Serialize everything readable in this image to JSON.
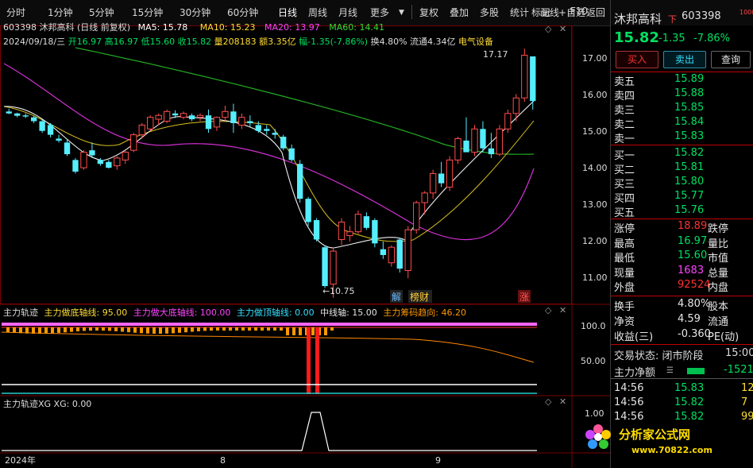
{
  "toolbar": {
    "periods": [
      "分时",
      "1分钟",
      "5分钟",
      "15分钟",
      "30分钟",
      "60分钟",
      "日线",
      "周线",
      "月线",
      "更多"
    ],
    "tools": [
      "复权",
      "叠加",
      "多股",
      "统计",
      "画线",
      "F10",
      "标记",
      "+自选",
      "返回"
    ]
  },
  "info": {
    "line1_code": "603398 沐邦高科 (日线 前复权)",
    "ma5": "MA5: 15.78",
    "ma10": "MA10: 15.23",
    "ma20": "MA20: 13.97",
    "ma60": "MA60: 14.41",
    "line2_date": "2024/09/18/三",
    "open": "开16.97",
    "high": "高16.97",
    "low": "低15.60",
    "close": "收15.82",
    "vol": "量208183",
    "amt": "额3.35亿",
    "chg": "幅-1.35(-7.86%)",
    "turnover": "换4.80%",
    "float": "流通4.34亿",
    "industry": "电气设备"
  },
  "price_axis": [
    "17.00",
    "16.00",
    "15.00",
    "14.00",
    "13.00",
    "12.00",
    "11.00"
  ],
  "annotations": {
    "high": "17.17",
    "low": "10.75",
    "tag_jie": "解",
    "tag_bangcai": "榜财",
    "tag_zhang": "涨"
  },
  "ind1": {
    "name": "主力轨迹",
    "l1": "主力做底轴线: 95.00",
    "l2": "主力做大底轴线: 100.00",
    "l3": "主力做顶轴线: 0.00",
    "l4": "中线轴: 15.00",
    "l5": "主力筹码趋向: 46.20",
    "axis": [
      "100.0",
      "50.00"
    ]
  },
  "ind2": {
    "title": "主力轨迹XG XG: 0.00",
    "axis": "1.00"
  },
  "xaxis": [
    "2024年",
    "8",
    "9"
  ],
  "stock": {
    "name": "沐邦高科",
    "code": "603398",
    "price": "15.82",
    "chg": "-1.35",
    "pct": "-7.86%",
    "tag": "下",
    "sup": "1000"
  },
  "buttons": [
    "买入",
    "卖出",
    "查询"
  ],
  "asks": [
    {
      "label": "卖五",
      "price": "15.89"
    },
    {
      "label": "卖四",
      "price": "15.88"
    },
    {
      "label": "卖三",
      "price": "15.85"
    },
    {
      "label": "卖二",
      "price": "15.84"
    },
    {
      "label": "卖一",
      "price": "15.83"
    }
  ],
  "bids": [
    {
      "label": "买一",
      "price": "15.82"
    },
    {
      "label": "买二",
      "price": "15.81"
    },
    {
      "label": "买三",
      "price": "15.80"
    },
    {
      "label": "买四",
      "price": "15.77"
    },
    {
      "label": "买五",
      "price": "15.76"
    }
  ],
  "stats": [
    {
      "l": "涨停",
      "v": "18.89",
      "r": "跌停"
    },
    {
      "l": "最高",
      "v": "16.97",
      "r": "量比"
    },
    {
      "l": "最低",
      "v": "15.60",
      "r": "市值"
    },
    {
      "l": "现量",
      "v": "1683",
      "r": "总量"
    },
    {
      "l": "外盘",
      "v": "92524",
      "r": "内盘"
    }
  ],
  "stats2": [
    {
      "l": "换手",
      "v": "4.80%",
      "r": "股本"
    },
    {
      "l": "净资",
      "v": "4.59",
      "r": "流通"
    },
    {
      "l": "收益(三)",
      "v": "-0.360",
      "r": "PE(动)"
    }
  ],
  "trade_state": "交易状态: 闭市阶段",
  "trade_time": "15:00",
  "net": {
    "label": "主力净额",
    "value": "-1521"
  },
  "ticks": [
    {
      "t": "14:56",
      "p": "15.83",
      "v": "12"
    },
    {
      "t": "14:56",
      "p": "15.82",
      "v": "7"
    },
    {
      "t": "14:56",
      "p": "15.82",
      "v": "99"
    }
  ],
  "watermark": {
    "text": "分析家公式网",
    "url": "www.70822.com"
  },
  "chart_data": {
    "type": "candlestick",
    "ylim": [
      10.6,
      17.4
    ],
    "candles": [
      [
        15.55,
        15.62,
        15.48,
        15.5
      ],
      [
        15.5,
        15.52,
        15.4,
        15.44
      ],
      [
        15.45,
        15.5,
        15.38,
        15.42
      ],
      [
        15.4,
        15.45,
        15.25,
        15.3
      ],
      [
        15.3,
        15.35,
        15.0,
        15.05
      ],
      [
        15.2,
        15.25,
        14.88,
        14.95
      ],
      [
        14.85,
        14.95,
        14.75,
        14.8
      ],
      [
        14.75,
        14.85,
        14.4,
        14.45
      ],
      [
        14.3,
        14.35,
        13.95,
        14.0
      ],
      [
        14.1,
        14.55,
        14.05,
        14.5
      ],
      [
        14.55,
        14.75,
        14.35,
        14.42
      ],
      [
        14.3,
        14.35,
        14.15,
        14.2
      ],
      [
        14.25,
        14.3,
        14.08,
        14.1
      ],
      [
        14.15,
        14.4,
        14.05,
        14.35
      ],
      [
        14.3,
        14.55,
        14.2,
        14.5
      ],
      [
        14.55,
        15.0,
        14.5,
        14.95
      ],
      [
        14.95,
        15.25,
        14.85,
        15.2
      ],
      [
        15.1,
        15.45,
        15.05,
        15.4
      ],
      [
        15.35,
        15.5,
        15.2,
        15.45
      ],
      [
        15.3,
        15.6,
        15.25,
        15.55
      ],
      [
        15.5,
        15.58,
        15.38,
        15.45
      ],
      [
        15.4,
        15.55,
        15.35,
        15.5
      ],
      [
        15.45,
        15.5,
        15.3,
        15.35
      ],
      [
        15.4,
        15.5,
        15.3,
        15.45
      ],
      [
        15.45,
        15.6,
        15.0,
        15.1
      ],
      [
        15.15,
        15.42,
        15.05,
        15.4
      ],
      [
        15.4,
        15.7,
        15.3,
        15.55
      ],
      [
        15.55,
        15.75,
        15.0,
        15.25
      ],
      [
        15.2,
        15.5,
        15.1,
        15.4
      ],
      [
        15.3,
        15.45,
        15.15,
        15.25
      ],
      [
        15.2,
        15.3,
        15.0,
        15.05
      ],
      [
        15.1,
        15.2,
        14.95,
        15.05
      ],
      [
        15.0,
        15.1,
        14.85,
        14.95
      ],
      [
        14.9,
        14.95,
        14.55,
        14.6
      ],
      [
        14.6,
        14.7,
        14.25,
        14.3
      ],
      [
        14.2,
        14.3,
        13.2,
        13.3
      ],
      [
        13.3,
        13.35,
        12.6,
        12.7
      ],
      [
        12.75,
        12.8,
        12.2,
        12.25
      ],
      [
        12.05,
        12.1,
        11.0,
        11.05
      ],
      [
        11.1,
        12.05,
        10.75,
        11.95
      ],
      [
        12.25,
        12.8,
        12.1,
        12.7
      ],
      [
        12.35,
        12.6,
        12.2,
        12.45
      ],
      [
        12.45,
        13.0,
        12.4,
        12.9
      ],
      [
        12.85,
        12.95,
        12.5,
        12.55
      ],
      [
        12.75,
        12.8,
        12.05,
        12.15
      ],
      [
        12.0,
        12.2,
        11.75,
        11.85
      ],
      [
        11.65,
        12.1,
        11.55,
        12.05
      ],
      [
        12.25,
        12.3,
        11.4,
        11.5
      ],
      [
        11.45,
        12.6,
        11.25,
        12.5
      ],
      [
        12.5,
        13.25,
        12.4,
        13.2
      ],
      [
        13.2,
        13.5,
        12.9,
        13.45
      ],
      [
        13.45,
        14.05,
        13.3,
        13.95
      ],
      [
        13.95,
        14.25,
        13.6,
        13.7
      ],
      [
        13.6,
        14.4,
        13.5,
        14.3
      ],
      [
        14.3,
        14.9,
        14.2,
        14.85
      ],
      [
        14.8,
        15.4,
        14.6,
        14.5
      ],
      [
        14.5,
        15.2,
        14.4,
        15.1
      ],
      [
        15.1,
        15.3,
        14.5,
        14.6
      ],
      [
        14.6,
        15.0,
        14.35,
        14.45
      ],
      [
        14.45,
        15.2,
        14.4,
        15.1
      ],
      [
        15.1,
        15.6,
        15.0,
        15.5
      ],
      [
        15.5,
        16.0,
        15.3,
        15.9
      ],
      [
        15.9,
        17.17,
        15.8,
        17.0
      ],
      [
        16.97,
        16.97,
        15.6,
        15.82
      ]
    ]
  }
}
